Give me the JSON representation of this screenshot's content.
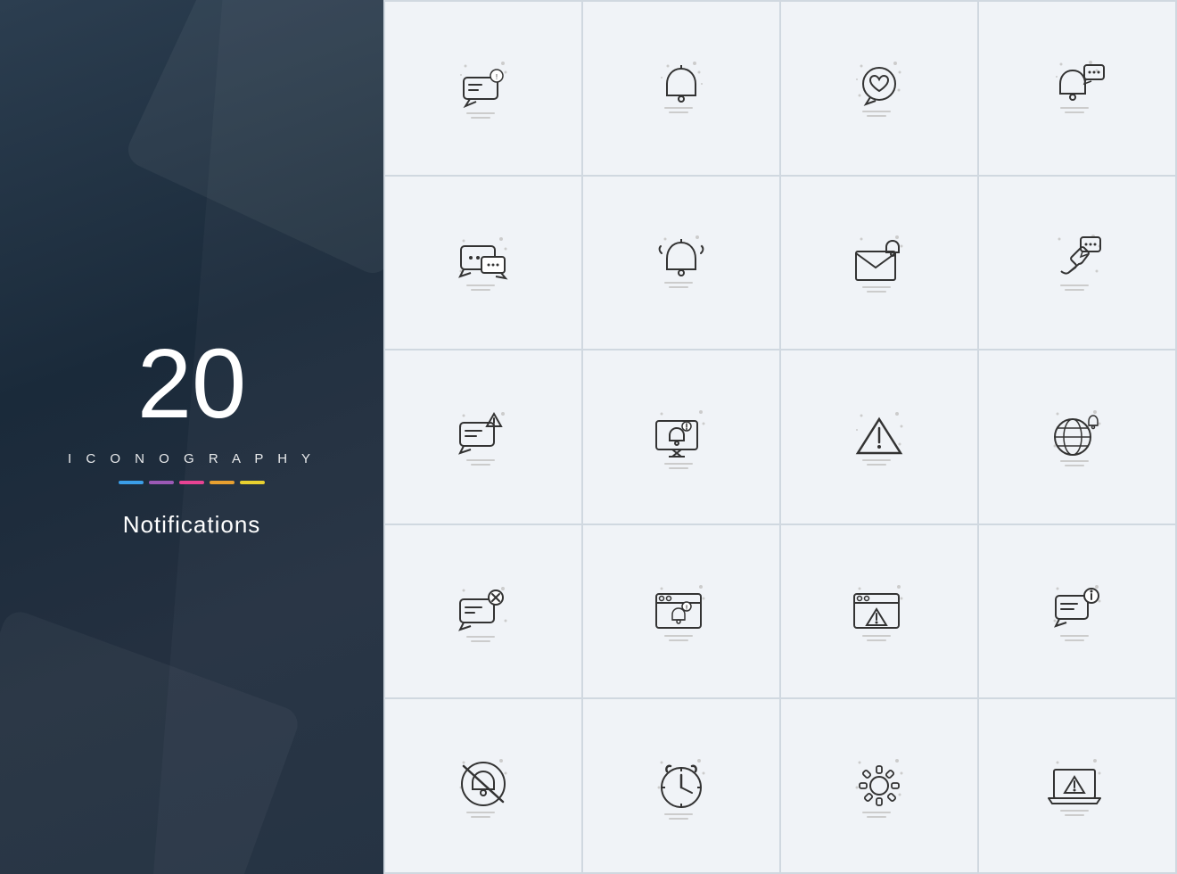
{
  "leftPanel": {
    "number": "20",
    "iconography": "I C O N O G R A P H Y",
    "title": "Notifications",
    "colorBars": [
      {
        "color": "#3b9ee8"
      },
      {
        "color": "#9b59b6"
      },
      {
        "color": "#e84393"
      },
      {
        "color": "#e8a030"
      },
      {
        "color": "#e8d030"
      }
    ]
  },
  "icons": [
    {
      "id": "chat-notification",
      "label": "Chat Notification"
    },
    {
      "id": "bell-notification",
      "label": "Bell Notification"
    },
    {
      "id": "chat-heart",
      "label": "Chat Heart"
    },
    {
      "id": "bell-chat",
      "label": "Bell Chat"
    },
    {
      "id": "chat-bubbles",
      "label": "Chat Bubbles"
    },
    {
      "id": "bell-ring",
      "label": "Bell Ring"
    },
    {
      "id": "mail-bell",
      "label": "Mail Bell"
    },
    {
      "id": "phone-chat",
      "label": "Phone Chat"
    },
    {
      "id": "chat-warning",
      "label": "Chat Warning"
    },
    {
      "id": "monitor-bell",
      "label": "Monitor Bell"
    },
    {
      "id": "triangle-warning",
      "label": "Triangle Warning"
    },
    {
      "id": "globe-bell",
      "label": "Globe Bell"
    },
    {
      "id": "chat-close",
      "label": "Chat Close"
    },
    {
      "id": "window-bell",
      "label": "Window Bell"
    },
    {
      "id": "window-warning",
      "label": "Window Warning"
    },
    {
      "id": "chat-info",
      "label": "Chat Info"
    },
    {
      "id": "mute-bell",
      "label": "Mute Bell"
    },
    {
      "id": "alarm-clock",
      "label": "Alarm Clock"
    },
    {
      "id": "gear",
      "label": "Gear"
    },
    {
      "id": "laptop-warning",
      "label": "Laptop Warning"
    }
  ]
}
